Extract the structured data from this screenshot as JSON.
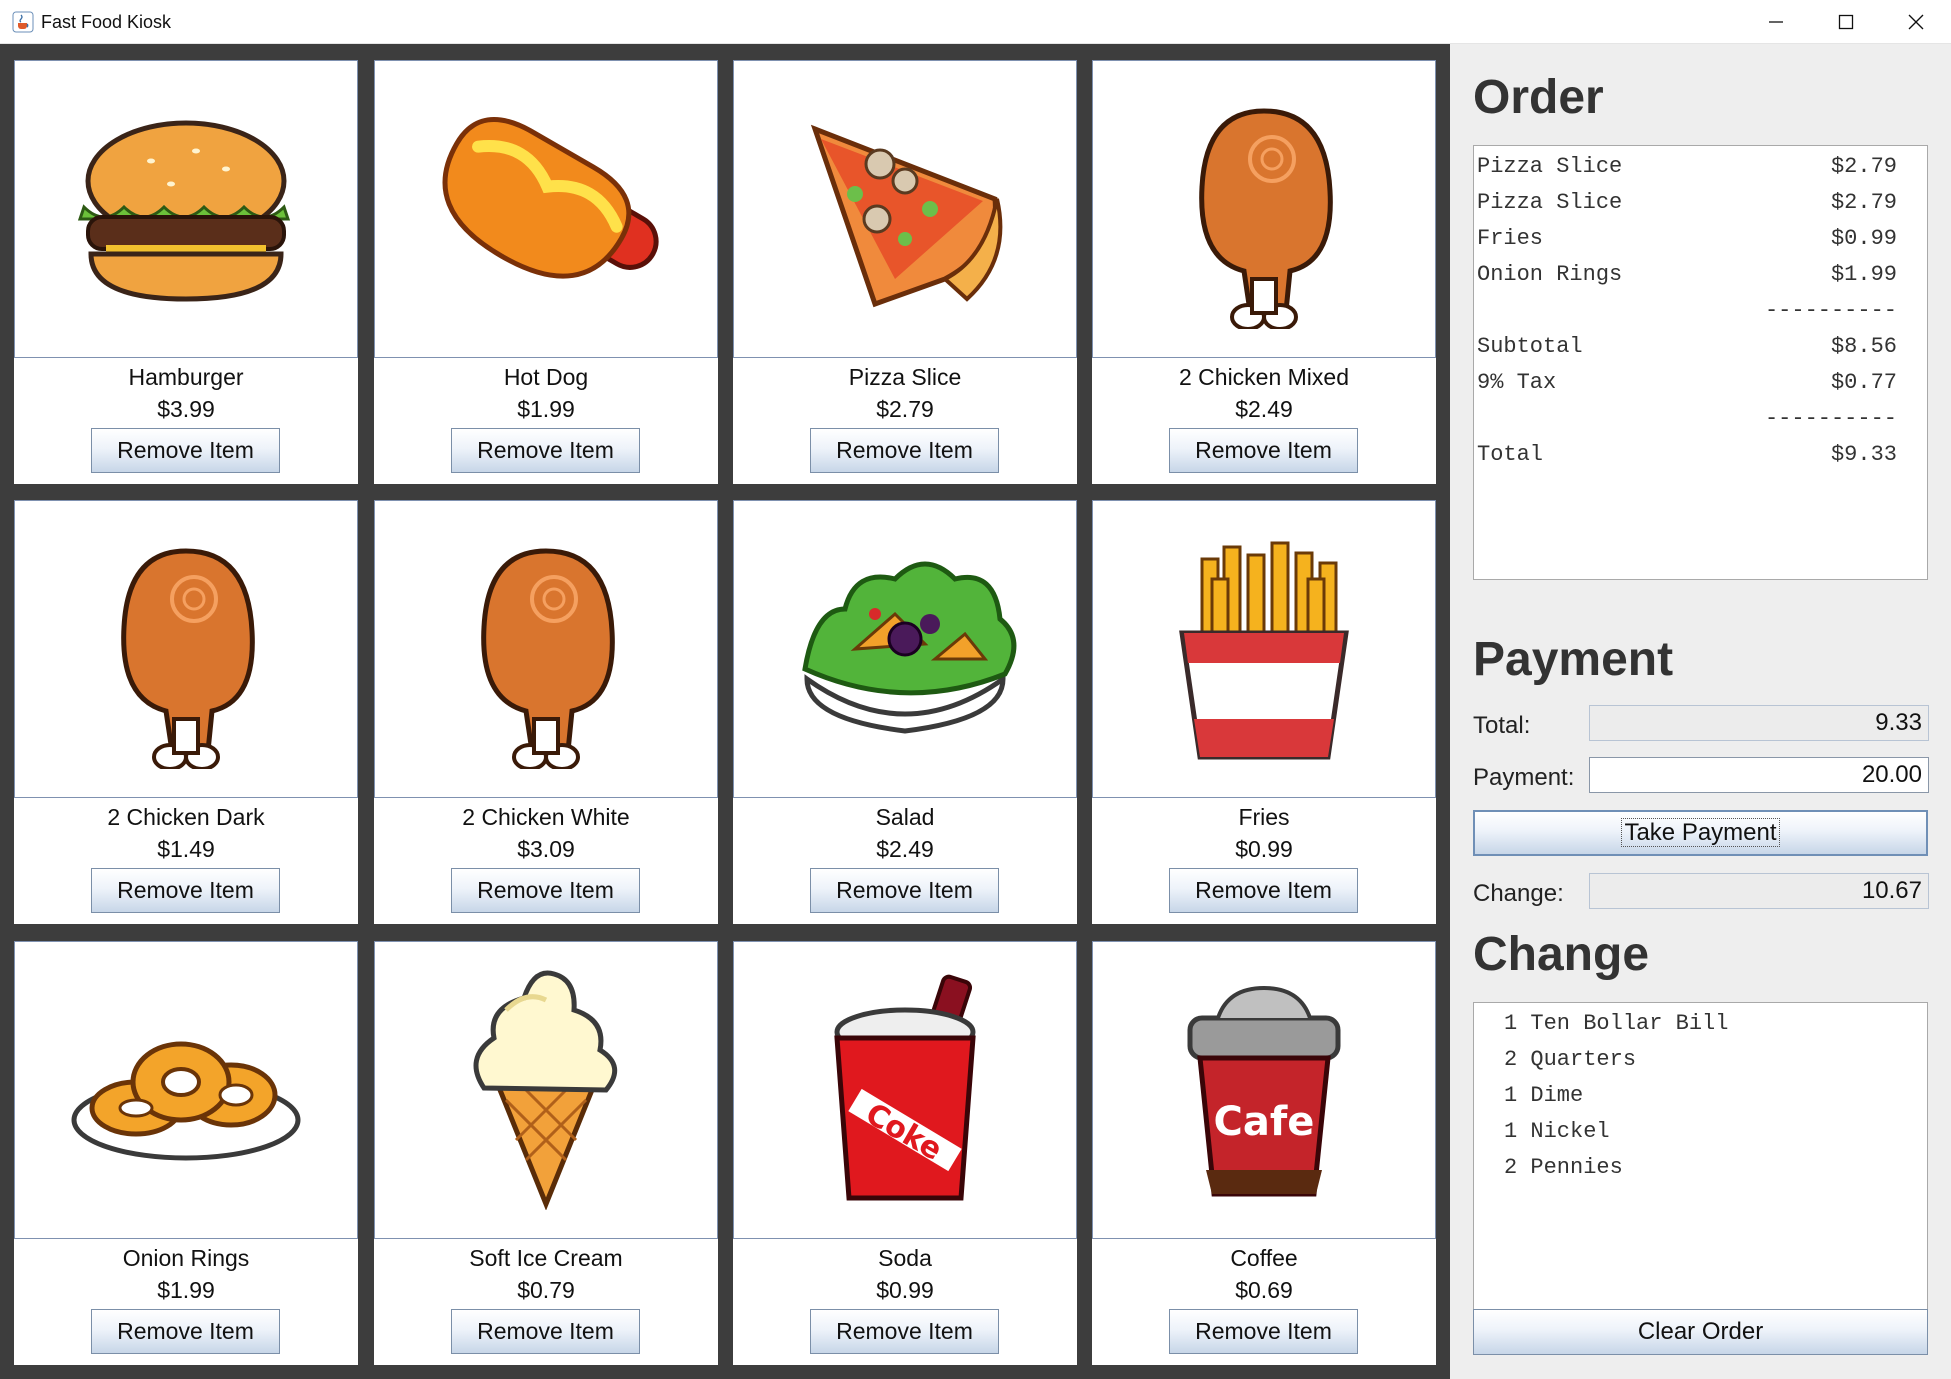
{
  "window": {
    "title": "Fast Food Kiosk",
    "icon": "java-cup-icon",
    "controls": [
      "minimize-icon",
      "maximize-icon",
      "close-icon"
    ]
  },
  "menu": {
    "remove_label": "Remove Item",
    "items": [
      {
        "name": "Hamburger",
        "price": "$3.99",
        "icon": "hamburger"
      },
      {
        "name": "Hot Dog",
        "price": "$1.99",
        "icon": "hot-dog"
      },
      {
        "name": "Pizza Slice",
        "price": "$2.79",
        "icon": "pizza-slice"
      },
      {
        "name": "2 Chicken Mixed",
        "price": "$2.49",
        "icon": "chicken-drumstick"
      },
      {
        "name": "2 Chicken Dark",
        "price": "$1.49",
        "icon": "chicken-drumstick"
      },
      {
        "name": "2 Chicken White",
        "price": "$3.09",
        "icon": "chicken-drumstick"
      },
      {
        "name": "Salad",
        "price": "$2.49",
        "icon": "salad"
      },
      {
        "name": "Fries",
        "price": "$0.99",
        "icon": "fries"
      },
      {
        "name": "Onion Rings",
        "price": "$1.99",
        "icon": "onion-rings"
      },
      {
        "name": "Soft Ice Cream",
        "price": "$0.79",
        "icon": "ice-cream-cone"
      },
      {
        "name": "Soda",
        "price": "$0.99",
        "icon": "soda-cup"
      },
      {
        "name": "Coffee",
        "price": "$0.69",
        "icon": "coffee-cup"
      }
    ]
  },
  "order": {
    "heading": "Order",
    "lines": [
      {
        "label": "Pizza Slice",
        "amount": "$2.79"
      },
      {
        "label": "Pizza Slice",
        "amount": "$2.79"
      },
      {
        "label": "Fries",
        "amount": "$0.99"
      },
      {
        "label": "Onion Rings",
        "amount": "$1.99"
      },
      {
        "label": "",
        "amount": "----------"
      },
      {
        "label": "Subtotal",
        "amount": "$8.56"
      },
      {
        "label": "9% Tax",
        "amount": "$0.77"
      },
      {
        "label": "",
        "amount": "----------"
      },
      {
        "label": "Total",
        "amount": "$9.33"
      }
    ]
  },
  "payment": {
    "heading": "Payment",
    "total_label": "Total:",
    "total_value": "9.33",
    "payment_label": "Payment:",
    "payment_value": "20.00",
    "take_payment_label": "Take Payment",
    "change_label": "Change:",
    "change_value": "10.67"
  },
  "change": {
    "heading": "Change",
    "lines": [
      "1 Ten Bollar Bill",
      "2 Quarters",
      "1 Dime",
      "1 Nickel",
      "2 Pennies"
    ],
    "clear_label": "Clear Order"
  }
}
